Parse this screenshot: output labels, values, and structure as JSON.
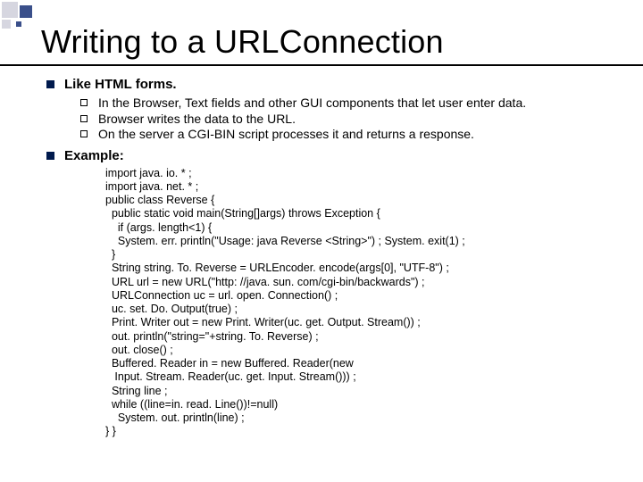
{
  "title": "Writing to a URLConnection",
  "bullets": {
    "b1": {
      "heading": "Like HTML forms.",
      "sub": [
        "In the Browser, Text fields and other GUI components that let user enter data.",
        "Browser writes the data to the URL.",
        "On the server a CGI-BIN script processes it and returns a response."
      ]
    },
    "b2": {
      "heading": "Example:"
    }
  },
  "code": "import java. io. * ;\nimport java. net. * ;\npublic class Reverse {\n  public static void main(String[]args) throws Exception {\n    if (args. length<1) {\n    System. err. println(\"Usage: java Reverse <String>\") ; System. exit(1) ;\n  }\n  String string. To. Reverse = URLEncoder. encode(args[0], \"UTF-8\") ;\n  URL url = new URL(\"http: //java. sun. com/cgi-bin/backwards\") ;\n  URLConnection uc = url. open. Connection() ;\n  uc. set. Do. Output(true) ;\n  Print. Writer out = new Print. Writer(uc. get. Output. Stream()) ;\n  out. println(\"string=\"+string. To. Reverse) ;\n  out. close() ;\n  Buffered. Reader in = new Buffered. Reader(new\n   Input. Stream. Reader(uc. get. Input. Stream())) ;\n  String line ;\n  while ((line=in. read. Line())!=null)\n    System. out. println(line) ;\n} }"
}
